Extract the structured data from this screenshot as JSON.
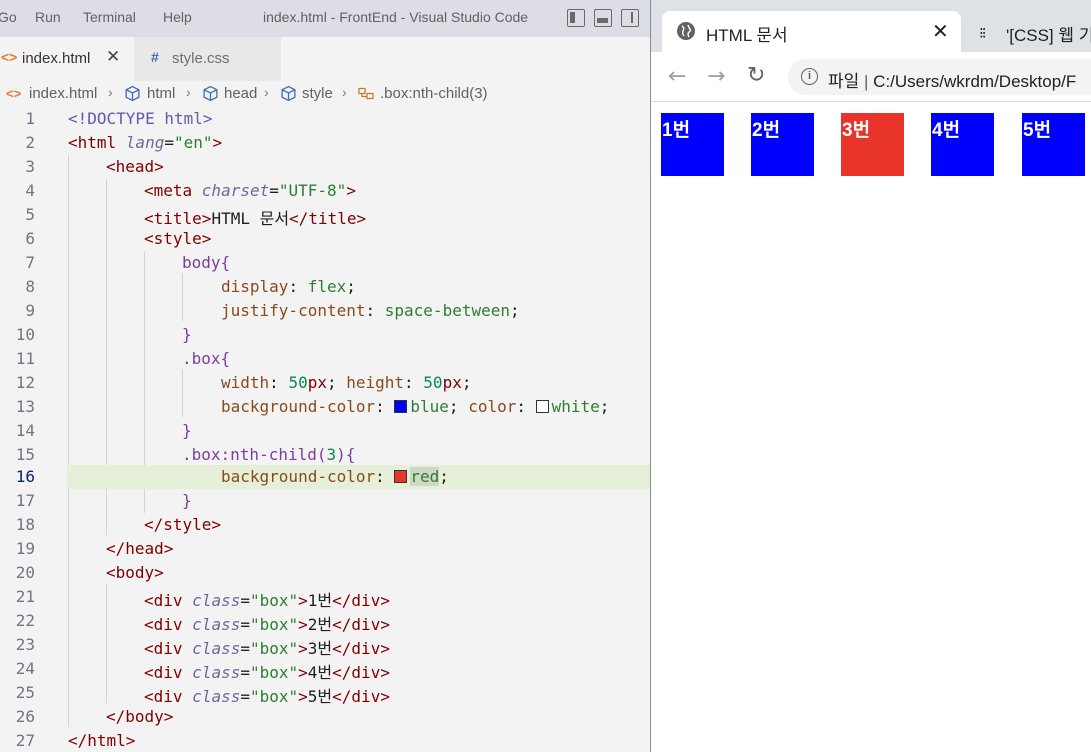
{
  "vscode": {
    "menu": [
      "Go",
      "Run",
      "Terminal",
      "Help"
    ],
    "window_title": "index.html - FrontEnd - Visual Studio Code",
    "tabs": [
      {
        "label": "index.html",
        "icon": "html-file-icon",
        "active": true
      },
      {
        "label": "style.css",
        "icon": "css-file-icon",
        "active": false
      }
    ],
    "breadcrumb": [
      "index.html",
      "html",
      "head",
      "style",
      ".box:nth-child(3)"
    ],
    "current_line": 16,
    "lines": [
      "1",
      "2",
      "3",
      "4",
      "5",
      "6",
      "7",
      "8",
      "9",
      "10",
      "11",
      "12",
      "13",
      "14",
      "15",
      "16",
      "17",
      "18",
      "19",
      "20",
      "21",
      "22",
      "23",
      "24",
      "25",
      "26",
      "27"
    ],
    "code": {
      "l1": "<!DOCTYPE html>",
      "l2_tag": "<html ",
      "l2_attr": "lang",
      "l2_eq": "=",
      "l2_val": "\"en\"",
      "l2_close": ">",
      "l3": "<head>",
      "l4_tag": "<meta ",
      "l4_attr": "charset",
      "l4_eq": "=",
      "l4_val": "\"UTF-8\"",
      "l4_close": ">",
      "l5_open": "<title>",
      "l5_text": "HTML 문서",
      "l5_close": "</title>",
      "l6": "<style>",
      "l7": "body{",
      "l8_prop": "display",
      "l8_colon": ": ",
      "l8_val": "flex",
      "l8_semi": ";",
      "l9_prop": "justify-content",
      "l9_colon": ": ",
      "l9_val": "space-between",
      "l9_semi": ";",
      "l10": "}",
      "l11": ".box{",
      "l12_p1": "width",
      "l12_c1": ": ",
      "l12_n1": "50",
      "l12_u1": "px",
      "l12_s1": "; ",
      "l12_p2": "height",
      "l12_c2": ": ",
      "l12_n2": "50",
      "l12_u2": "px",
      "l12_s2": ";",
      "l13_p1": "background-color",
      "l13_c1": ": ",
      "l13_v1": "blue",
      "l13_s1": "; ",
      "l13_p2": "color",
      "l13_c2": ": ",
      "l13_v2": "white",
      "l13_s2": ";",
      "l14": "}",
      "l15_sel": ".box:nth-child(",
      "l15_num": "3",
      "l15_end": "){",
      "l16_prop": "background-color",
      "l16_colon": ": ",
      "l16_val": "red",
      "l16_semi": ";",
      "l17": "}",
      "l18": "</style>",
      "l19": "</head>",
      "l20": "<body>",
      "box_open": "<div ",
      "box_attr": "class",
      "box_eq": "=",
      "box_val": "\"box\"",
      "box_gt": ">",
      "box_close": "</div>",
      "l21_text": "1번",
      "l22_text": "2번",
      "l23_text": "3번",
      "l24_text": "4번",
      "l25_text": "5번",
      "l26": "</body>",
      "l27": "</html>"
    },
    "swatch_colors": {
      "blue": "#0000ff",
      "white": "#ffffff",
      "red": "#e8342a"
    }
  },
  "browser": {
    "active_tab_title": "HTML 문서",
    "inactive_tab_title": "'[CSS] 웹 기",
    "address_label": "파일",
    "address_separator": "|",
    "address_url": "C:/Users/wkrdm/Desktop/F",
    "boxes": [
      {
        "label": "1번",
        "color": "#0000ff"
      },
      {
        "label": "2번",
        "color": "#0000ff"
      },
      {
        "label": "3번",
        "color": "#e8342a"
      },
      {
        "label": "4번",
        "color": "#0000ff"
      },
      {
        "label": "5번",
        "color": "#0000ff"
      }
    ]
  }
}
